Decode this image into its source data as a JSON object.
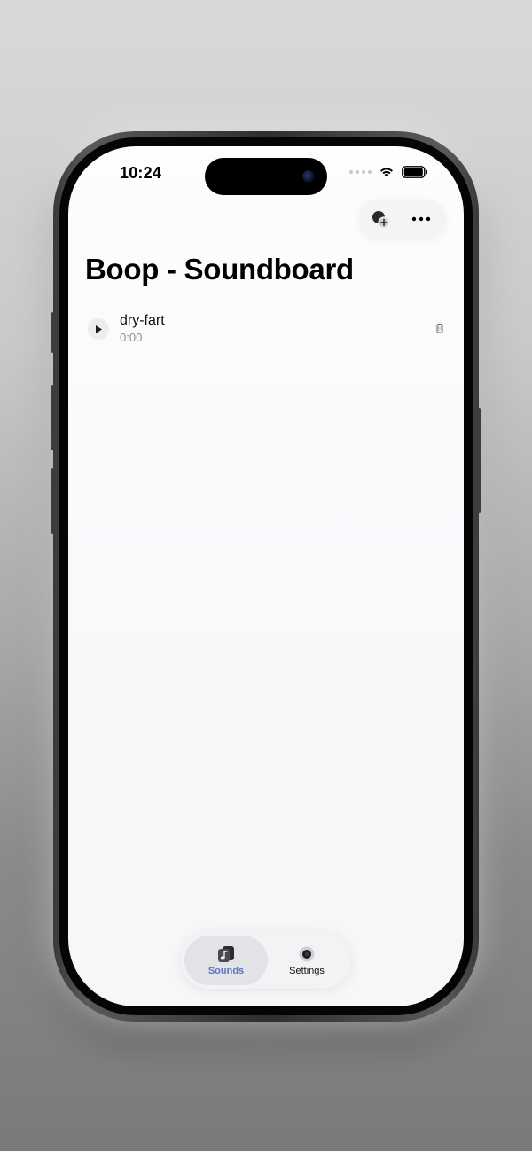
{
  "status_bar": {
    "time": "10:24"
  },
  "toolbar": {
    "add_icon": "add-sound-icon",
    "more_icon": "ellipsis-icon"
  },
  "page": {
    "title": "Boop - Soundboard"
  },
  "sounds": [
    {
      "name": "dry-fart",
      "duration": "0:00"
    }
  ],
  "tab_bar": {
    "tabs": [
      {
        "label": "Sounds",
        "icon": "music-note-icon",
        "selected": true
      },
      {
        "label": "Settings",
        "icon": "gear-icon",
        "selected": false
      }
    ]
  },
  "colors": {
    "accent": "#5a74c8",
    "background": "#fbfafc",
    "text_primary": "#000000",
    "text_secondary": "#8a8a8e"
  }
}
